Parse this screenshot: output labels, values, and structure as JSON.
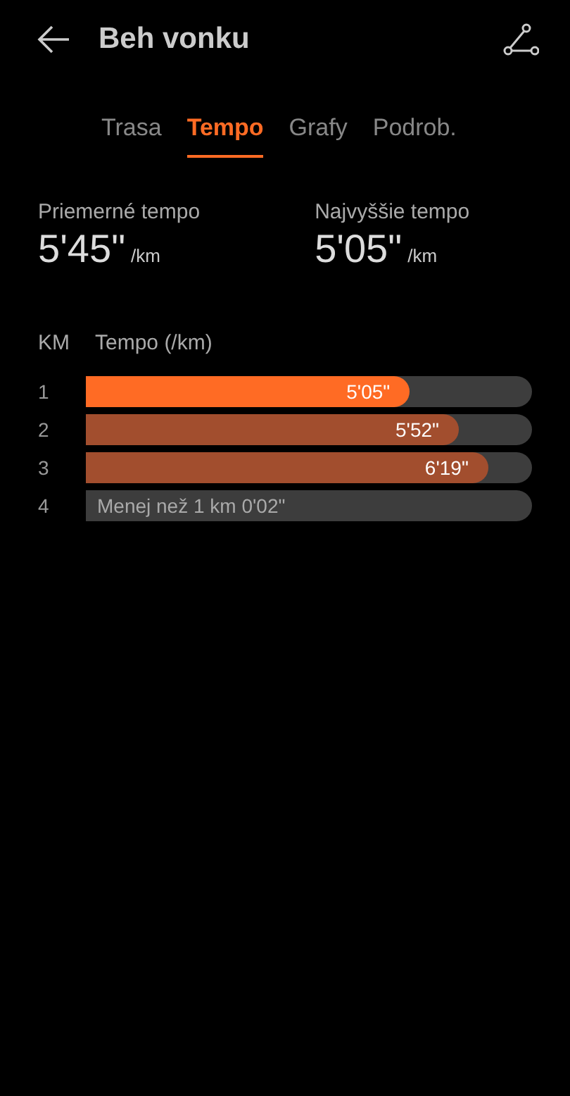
{
  "header": {
    "title": "Beh vonku"
  },
  "tabs": [
    {
      "label": "Trasa",
      "selected": false
    },
    {
      "label": "Tempo",
      "selected": true
    },
    {
      "label": "Grafy",
      "selected": false
    },
    {
      "label": "Podrob.",
      "selected": false
    }
  ],
  "stats": [
    {
      "label": "Priemerné tempo",
      "value": "5'45\"",
      "unit": "/km"
    },
    {
      "label": "Najvyššie tempo",
      "value": "5'05\"",
      "unit": "/km"
    }
  ],
  "splits": {
    "columns": [
      "KM",
      "Tempo (/km)"
    ],
    "rows": [
      {
        "km": "1",
        "kind": "full",
        "level": 0.726,
        "fastest": true,
        "pace": "5'05\""
      },
      {
        "km": "2",
        "kind": "full",
        "level": 0.836,
        "fastest": false,
        "pace": "5'52\""
      },
      {
        "km": "3",
        "kind": "full",
        "level": 0.902,
        "fastest": false,
        "pace": "6'19\""
      },
      {
        "km": "4",
        "kind": "partial",
        "pace": "Menej než 1 km 0'02\""
      }
    ]
  }
}
